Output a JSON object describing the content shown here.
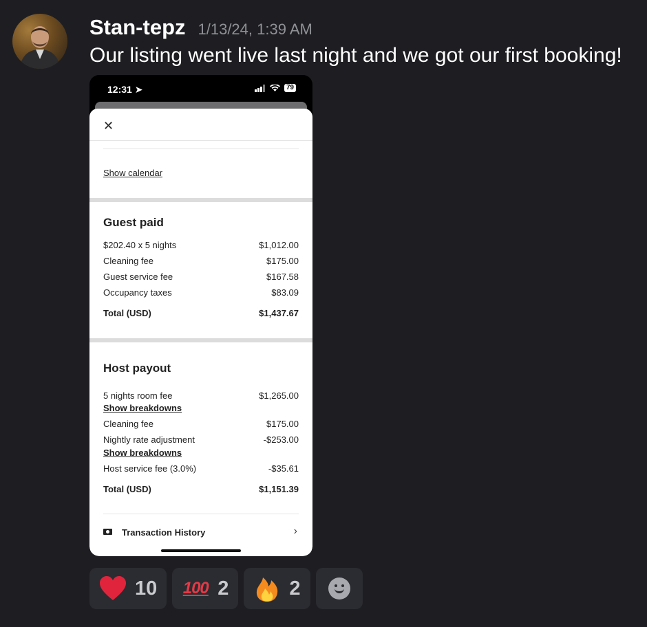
{
  "message": {
    "author": "Stan-tepz",
    "timestamp": "1/13/24, 1:39 AM",
    "text": "Our listing went live last night and we got our first booking!"
  },
  "phone": {
    "status_time": "12:31",
    "battery": "79",
    "show_calendar": "Show calendar",
    "guest_paid": {
      "title": "Guest paid",
      "rows": [
        {
          "label": "$202.40 x 5 nights",
          "value": "$1,012.00"
        },
        {
          "label": "Cleaning fee",
          "value": "$175.00"
        },
        {
          "label": "Guest service fee",
          "value": "$167.58"
        },
        {
          "label": "Occupancy taxes",
          "value": "$83.09"
        }
      ],
      "total_label": "Total (USD)",
      "total_value": "$1,437.67"
    },
    "host_payout": {
      "title": "Host payout",
      "rows": [
        {
          "label": "5 nights room fee",
          "value": "$1,265.00"
        },
        {
          "label": "Cleaning fee",
          "value": "$175.00"
        },
        {
          "label": "Nightly rate adjustment",
          "value": "-$253.00"
        },
        {
          "label": "Host service fee (3.0%)",
          "value": "-$35.61"
        }
      ],
      "breakdown_link": "Show breakdowns",
      "total_label": "Total (USD)",
      "total_value": "$1,151.39"
    },
    "transaction_history": "Transaction History"
  },
  "reactions": [
    {
      "emoji": "heart",
      "count": "10"
    },
    {
      "emoji": "hundred-points",
      "count": "2",
      "glyph": "100"
    },
    {
      "emoji": "fire",
      "count": "2"
    }
  ],
  "icons": {
    "close": "close-icon",
    "chevron": "chevron-right-icon",
    "add_reaction": "smiley-icon"
  },
  "colors": {
    "background": "#1e1e22",
    "reaction_bg": "#2b2c31",
    "heart": "#e0243c"
  }
}
